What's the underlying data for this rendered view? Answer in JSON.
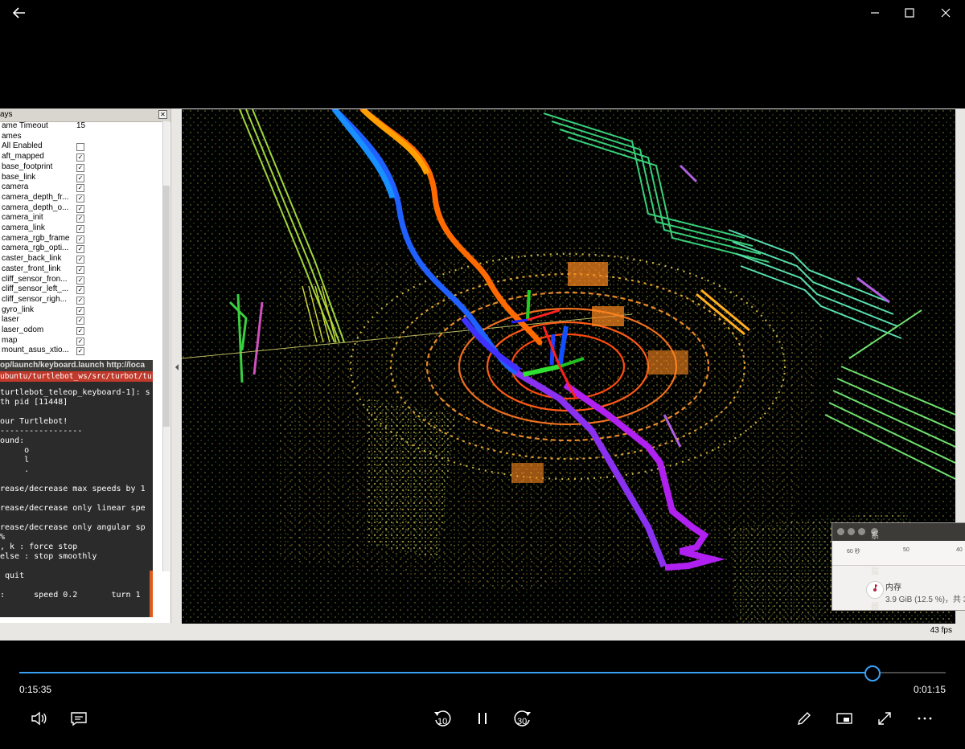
{
  "window": {
    "back": "back-arrow",
    "minimize": "minimize",
    "maximize": "maximize",
    "close": "close"
  },
  "displays": {
    "title": "ays",
    "rows": [
      {
        "name": "ame Timeout",
        "value": "15"
      },
      {
        "name": "ames",
        "value": ""
      },
      {
        "name": "All Enabled",
        "value": ""
      },
      {
        "name": "aft_mapped",
        "value": "✓"
      },
      {
        "name": "base_footprint",
        "value": "✓"
      },
      {
        "name": "base_link",
        "value": "✓"
      },
      {
        "name": "camera",
        "value": "✓"
      },
      {
        "name": "camera_depth_fr...",
        "value": "✓"
      },
      {
        "name": "camera_depth_o...",
        "value": "✓"
      },
      {
        "name": "camera_init",
        "value": "✓"
      },
      {
        "name": "camera_link",
        "value": "✓"
      },
      {
        "name": "camera_rgb_frame",
        "value": "✓"
      },
      {
        "name": "camera_rgb_opti...",
        "value": "✓"
      },
      {
        "name": "caster_back_link",
        "value": "✓"
      },
      {
        "name": "caster_front_link",
        "value": "✓"
      },
      {
        "name": "cliff_sensor_fron...",
        "value": "✓"
      },
      {
        "name": "cliff_sensor_left_...",
        "value": "✓"
      },
      {
        "name": "cliff_sensor_righ...",
        "value": "✓"
      },
      {
        "name": "gyro_link",
        "value": "✓"
      },
      {
        "name": "laser",
        "value": "✓"
      },
      {
        "name": "laser_odom",
        "value": "✓"
      },
      {
        "name": "map",
        "value": "✓"
      },
      {
        "name": "mount_asus_xtio...",
        "value": "✓"
      }
    ]
  },
  "terminal": {
    "title": "op/launch/keyboard.launch http://loca",
    "path": "ubuntu/turtlebot_ws/src/turbot/turbot_tel",
    "lines": [
      "turtlebot_teleop_keyboard-1]: s",
      "th pid [11448]",
      "",
      "our Turtlebot!",
      "-----------------",
      "ound:",
      "     o",
      "     l",
      "     .",
      "",
      "rease/decrease max speeds by 1",
      "",
      "rease/decrease only linear spe",
      "",
      "rease/decrease only angular sp",
      "%",
      ", k : force stop",
      "else : stop smoothly",
      "",
      " quit",
      "",
      ":      speed 0.2       turn 1"
    ]
  },
  "viewport": {
    "fps": "43 fps"
  },
  "sysmon": {
    "title": "系统监视器",
    "axis": [
      "60 秒",
      "50",
      "40"
    ],
    "label": "内存",
    "value": "3.9 GiB (12.5 %)，共 3"
  },
  "player": {
    "elapsed": "0:15:35",
    "remaining": "0:01:15",
    "progress": 0.921,
    "skip_back": "10",
    "skip_forward": "30"
  }
}
